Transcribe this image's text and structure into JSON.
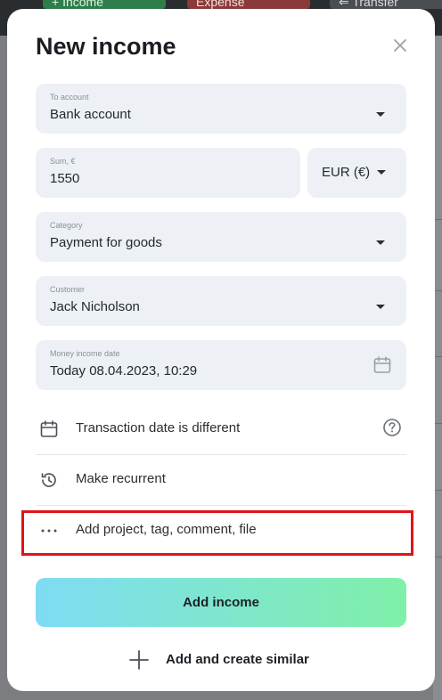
{
  "background": {
    "tabs": [
      {
        "label": "+ Income"
      },
      {
        "label": "Expense"
      },
      {
        "label": "⇐ Transfer"
      }
    ]
  },
  "modal": {
    "title": "New income",
    "fields": {
      "to_account": {
        "label": "To account",
        "value": "Bank account"
      },
      "sum": {
        "label": "Sum, €",
        "value": "1550"
      },
      "currency": {
        "value": "EUR (€)"
      },
      "category": {
        "label": "Category",
        "value": "Payment for goods"
      },
      "customer": {
        "label": "Customer",
        "value": "Jack Nicholson"
      },
      "date": {
        "label": "Money income date",
        "value": "Today 08.04.2023, 10:29"
      }
    },
    "options": {
      "transaction_date": "Transaction date is different",
      "recurrent": "Make recurrent",
      "more": "Add project, tag, comment, file"
    },
    "buttons": {
      "add_income": "Add income",
      "add_similar": "Add and create similar"
    }
  },
  "icons": {
    "close": "close-icon",
    "calendar": "calendar-icon",
    "help": "question-circle-icon",
    "history": "history-icon",
    "more": "ellipsis-icon",
    "plus": "plus-icon"
  },
  "colors": {
    "highlight": "#e0141b",
    "button_gradient_start": "#7edcf4",
    "button_gradient_end": "#7ff0a8",
    "field_bg": "#edf1f5"
  }
}
